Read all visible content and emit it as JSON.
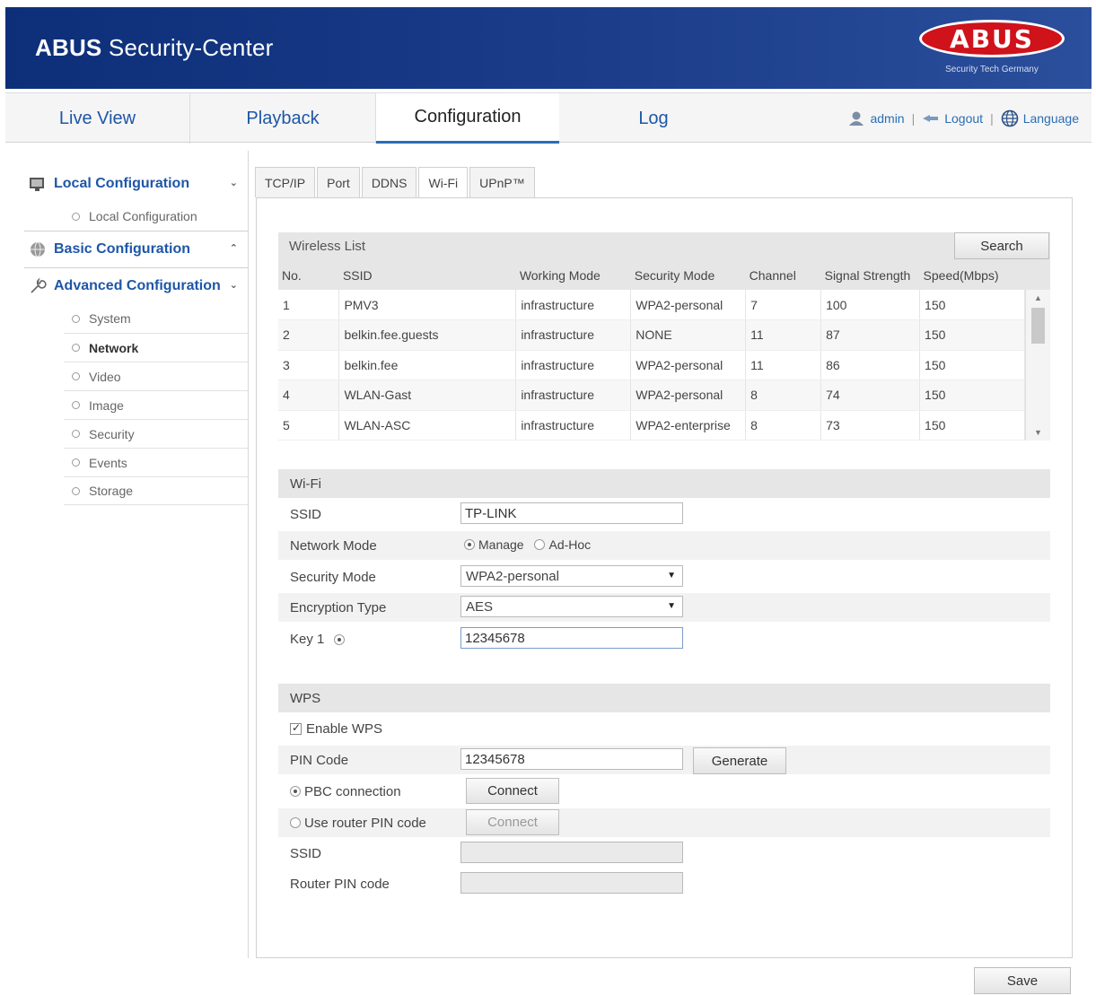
{
  "header": {
    "title_bold": "ABUS",
    "title_rest": "Security-Center",
    "logo_text": "ABUS",
    "logo_tagline": "Security Tech Germany"
  },
  "nav": {
    "tabs": [
      {
        "label": "Live View"
      },
      {
        "label": "Playback"
      },
      {
        "label": "Configuration"
      },
      {
        "label": "Log"
      }
    ],
    "user": "admin",
    "logout": "Logout",
    "language": "Language",
    "separator": "|"
  },
  "sidebar": {
    "local": {
      "label": "Local Configuration",
      "items": [
        "Local Configuration"
      ]
    },
    "basic": {
      "label": "Basic Configuration"
    },
    "advanced": {
      "label": "Advanced Configuration",
      "items": [
        "System",
        "Network",
        "Video",
        "Image",
        "Security",
        "Events",
        "Storage"
      ]
    }
  },
  "tabs": [
    "TCP/IP",
    "Port",
    "DDNS",
    "Wi-Fi",
    "UPnP™"
  ],
  "wireless": {
    "title": "Wireless List",
    "search": "Search",
    "columns": [
      "No.",
      "SSID",
      "Working Mode",
      "Security Mode",
      "Channel",
      "Signal Strength",
      "Speed(Mbps)"
    ],
    "rows": [
      [
        "1",
        "PMV3",
        "infrastructure",
        "WPA2-personal",
        "7",
        "100",
        "150"
      ],
      [
        "2",
        "belkin.fee.guests",
        "infrastructure",
        "NONE",
        "11",
        "87",
        "150"
      ],
      [
        "3",
        "belkin.fee",
        "infrastructure",
        "WPA2-personal",
        "11",
        "86",
        "150"
      ],
      [
        "4",
        "WLAN-Gast",
        "infrastructure",
        "WPA2-personal",
        "8",
        "74",
        "150"
      ],
      [
        "5",
        "WLAN-ASC",
        "infrastructure",
        "WPA2-enterprise",
        "8",
        "73",
        "150"
      ]
    ]
  },
  "wifi": {
    "title": "Wi-Fi",
    "ssid_label": "SSID",
    "ssid_value": "TP-LINK",
    "network_mode_label": "Network Mode",
    "mode_manage": "Manage",
    "mode_adhoc": "Ad-Hoc",
    "security_mode_label": "Security Mode",
    "security_mode_value": "WPA2-personal",
    "encryption_label": "Encryption Type",
    "encryption_value": "AES",
    "key_label": "Key 1",
    "key_value": "12345678"
  },
  "wps": {
    "title": "WPS",
    "enable_label": "Enable WPS",
    "pin_label": "PIN Code",
    "pin_value": "12345678",
    "generate": "Generate",
    "pbc_label": "PBC connection",
    "connect": "Connect",
    "router_pin_label": "Use router PIN code",
    "connect2": "Connect",
    "ssid_label": "SSID",
    "router_pin_code_label": "Router PIN code"
  },
  "save": "Save",
  "colors": {
    "header_blue": "#0d2f79",
    "link_blue": "#1e56a8",
    "logo_red": "#d0121b"
  }
}
